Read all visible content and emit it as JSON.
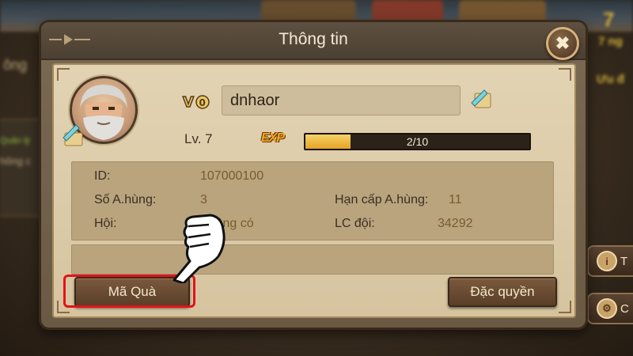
{
  "background": {
    "left_text_1": "ông",
    "left_text_2": "Quản lý",
    "left_text_3": "hông c",
    "right_top_text": "7",
    "right_top_text_2": "7 ng",
    "right_mid_text": "Ưu đ",
    "right_buttons": [
      {
        "icon": "info-icon",
        "label": "T"
      },
      {
        "icon": "gear-icon",
        "label": "C"
      }
    ]
  },
  "dialog": {
    "title": "Thông tin",
    "close_icon": "close-icon"
  },
  "profile": {
    "vip_badge": "V0",
    "name": "dnhaor",
    "level_label": "Lv. 7",
    "exp_label": "EXP",
    "exp_text": "2/10",
    "exp_fraction": 0.2
  },
  "info": {
    "id_label": "ID:",
    "id_value": "107000100",
    "heroes_label": "Số A.hùng:",
    "heroes_value": "3",
    "hero_cap_label": "Hạn cấp A.hùng:",
    "hero_cap_value": "11",
    "guild_label": "Hội:",
    "guild_value": "Không có",
    "team_power_label": "LC đội:",
    "team_power_value": "34292"
  },
  "buttons": {
    "gift_code": "Mã Quà",
    "privileges": "Đặc quyền"
  },
  "colors": {
    "highlight": "#e3121b",
    "exp_fill": "#e6a324",
    "parchment": "#d6c49f"
  }
}
